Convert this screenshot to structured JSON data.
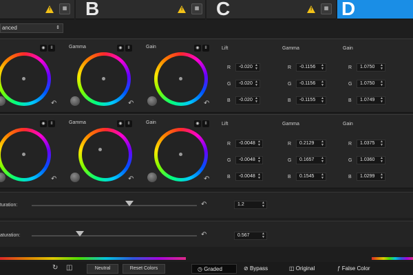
{
  "tabs": [
    {
      "letter": "B"
    },
    {
      "letter": "C"
    },
    {
      "letter": "D"
    }
  ],
  "mode": {
    "value": "anced"
  },
  "wheel_labels": {
    "lift": "",
    "gamma": "Gamma",
    "gain": "Gain"
  },
  "numeric_labels": {
    "lift": "Lift",
    "gamma": "Gamma",
    "gain": "Gain"
  },
  "channels": {
    "r": "R",
    "g": "G",
    "b": "B"
  },
  "panel1": {
    "lift": [
      "-0.020",
      "-0.020",
      "-0.020"
    ],
    "gamma": [
      "-0.1156",
      "-0.1156",
      "-0.1155"
    ],
    "gain": [
      "1.0750",
      "1.0750",
      "1.0749"
    ]
  },
  "panel2": {
    "lift": [
      "-0.0048",
      "-0.0048",
      "-0.0048"
    ],
    "gamma": [
      "0.2129",
      "0.1657",
      "0.1545"
    ],
    "gain": [
      "1.0375",
      "1.0360",
      "1.0299"
    ]
  },
  "saturation1": {
    "label": "turation:",
    "value": "1.2"
  },
  "saturation2": {
    "label": "aturation:",
    "value": "0.567"
  },
  "bottom": {
    "neutral": "Neutral",
    "reset_colors": "Reset Colors",
    "graded": "Graded",
    "bypass": "Bypass",
    "original": "Original",
    "false_color": "False Color"
  },
  "icons": [
    "warning-icon",
    "grid-icon",
    "reset-arrow-icon",
    "pin-icon",
    "pause-icon",
    "refresh-icon",
    "compare-icon"
  ]
}
